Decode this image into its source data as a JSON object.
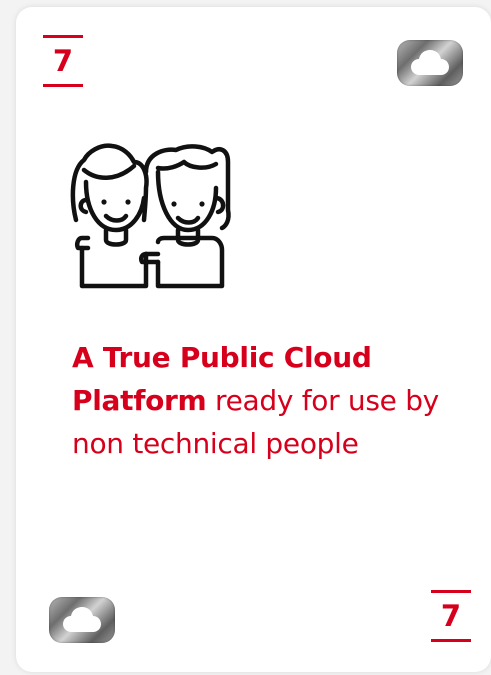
{
  "card": {
    "rank": "7",
    "headline_bold": "A True Public Cloud Platform",
    "headline_light": " ready for use by non technical people"
  },
  "icons": {
    "top_right": "cloud-icon",
    "bottom_left": "cloud-icon",
    "illustration": "two-friends-icon"
  },
  "colors": {
    "accent": "#d6001c",
    "card_background": "#ffffff",
    "page_background": "#f3f3f3"
  }
}
